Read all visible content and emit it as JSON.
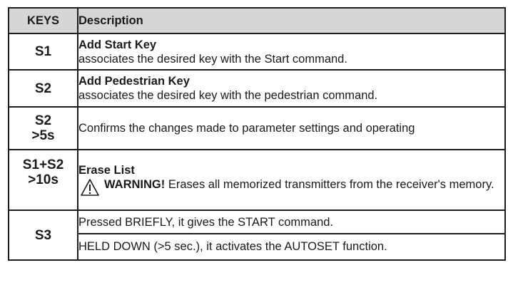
{
  "header": {
    "keys": "KEYS",
    "description": "Description"
  },
  "rows": [
    {
      "key": "S1",
      "title": "Add Start Key",
      "text": "associates the desired key with the Start command."
    },
    {
      "key": "S2",
      "title": "Add Pedestrian Key",
      "text": "associates the desired key with the pedestrian command."
    },
    {
      "key_line1": "S2",
      "key_line2": ">5s",
      "text": "Confirms the changes made to parameter settings and operating"
    },
    {
      "key_line1": "S1+S2",
      "key_line2": ">10s",
      "title": "Erase List",
      "warning_label": "WARNING!",
      "warning_text": "Erases all memorized transmitters from the receiver's memory.",
      "icon": "warning-triangle-icon"
    },
    {
      "key": "S3",
      "text_a": "Pressed BRIEFLY, it gives the START command.",
      "text_b": "HELD DOWN (>5 sec.), it activates the AUTOSET function."
    }
  ]
}
